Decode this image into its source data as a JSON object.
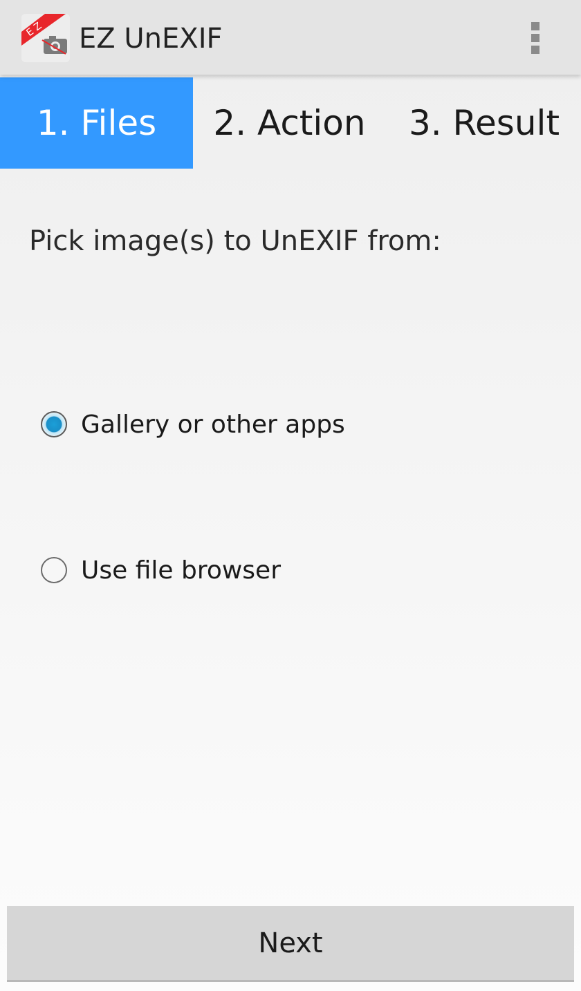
{
  "app": {
    "title": "EZ UnEXIF",
    "icon_name": "ez-unexif-app-icon",
    "icon_text": "E Z"
  },
  "action_bar": {
    "overflow_icon": "overflow-menu-icon"
  },
  "tabs": [
    {
      "label": "1. Files",
      "active": true
    },
    {
      "label": "2. Action",
      "active": false
    },
    {
      "label": "3. Result",
      "active": false
    }
  ],
  "main": {
    "prompt": "Pick image(s) to UnEXIF from:",
    "options": [
      {
        "label": "Gallery or other apps",
        "selected": true
      },
      {
        "label": "Use file browser",
        "selected": false
      }
    ]
  },
  "footer": {
    "next_label": "Next"
  },
  "colors": {
    "accent": "#3399ff",
    "radio_selected": "#1a8fc8",
    "action_bar": "#e4e4e4",
    "button": "#d6d6d6"
  }
}
